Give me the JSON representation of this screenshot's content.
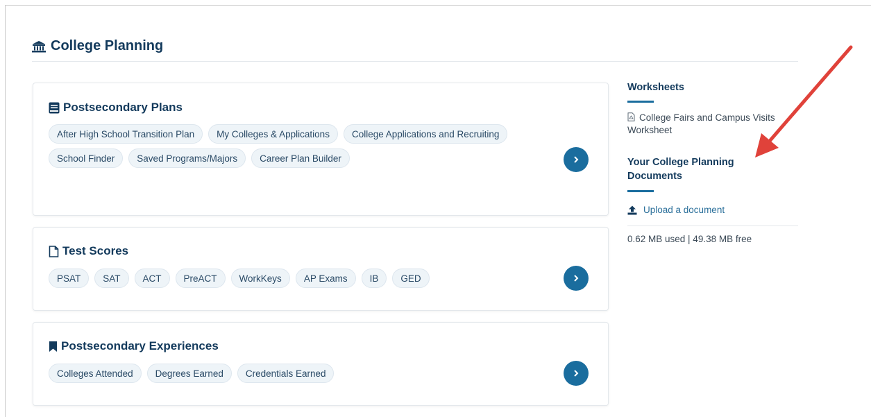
{
  "page": {
    "title": "College Planning"
  },
  "cards": [
    {
      "title": "Postsecondary Plans",
      "icon": "book-icon",
      "chips": [
        "After High School Transition Plan",
        "My Colleges & Applications",
        "College Applications and Recruiting",
        "School Finder",
        "Saved Programs/Majors",
        "Career Plan Builder"
      ],
      "button": "chevron-right-icon"
    },
    {
      "title": "Test Scores",
      "icon": "file-icon",
      "chips": [
        "PSAT",
        "SAT",
        "ACT",
        "PreACT",
        "WorkKeys",
        "AP Exams",
        "IB",
        "GED"
      ],
      "button": "chevron-right-icon"
    },
    {
      "title": "Postsecondary Experiences",
      "icon": "bookmark-icon",
      "chips": [
        "Colleges Attended",
        "Degrees Earned",
        "Credentials Earned"
      ],
      "button": "chevron-right-icon"
    }
  ],
  "sidebar": {
    "worksheets_heading": "Worksheets",
    "worksheet_link": "College Fairs and Campus Visits Worksheet",
    "documents_heading": "Your College Planning Documents",
    "upload_label": "Upload a document",
    "storage": "0.62 MB used | 49.38 MB free"
  },
  "colors": {
    "primary": "#1a6d9e",
    "heading": "#133a5c",
    "chip_bg": "#eef4f8",
    "arrow": "#e0423a"
  }
}
